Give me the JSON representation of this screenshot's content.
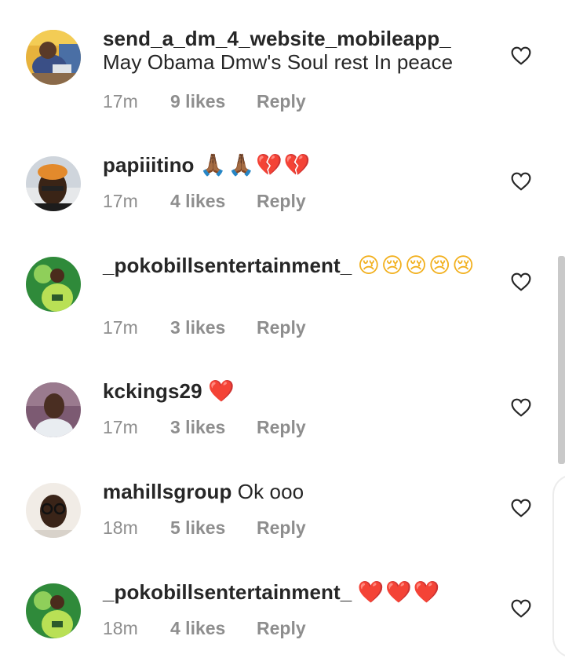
{
  "comments": [
    {
      "username": "send_a_dm_4_website_mobileapp_",
      "text": "May Obama Dmw's Soul rest In peace",
      "emoji": "",
      "emoji_color": "",
      "time": "17m",
      "likes": "9 likes",
      "reply": "Reply",
      "avatar_icon": "man-with-laptop-avatar"
    },
    {
      "username": "papiiitino",
      "text": "",
      "emoji": "🙏🏾🙏🏾💔💔",
      "emoji_color": "#e0202d",
      "time": "17m",
      "likes": "4 likes",
      "reply": "Reply",
      "avatar_icon": "orange-hair-avatar"
    },
    {
      "username": "_pokobillsentertainment_",
      "text": "",
      "emoji": "😢😢😢😢😢",
      "emoji_color": "",
      "time": "17m",
      "likes": "3 likes",
      "reply": "Reply",
      "avatar_icon": "basketball-player-avatar"
    },
    {
      "username": "kckings29",
      "text": "",
      "emoji": "❤️",
      "emoji_color": "#e0202d",
      "time": "17m",
      "likes": "3 likes",
      "reply": "Reply",
      "avatar_icon": "young-man-avatar"
    },
    {
      "username": "mahillsgroup",
      "text": "Ok ooo",
      "emoji": "",
      "emoji_color": "",
      "time": "18m",
      "likes": "5 likes",
      "reply": "Reply",
      "avatar_icon": "man-with-glasses-avatar"
    },
    {
      "username": "_pokobillsentertainment_",
      "text": "",
      "emoji": "❤️❤️❤️",
      "emoji_color": "#e0202d",
      "time": "18m",
      "likes": "4 likes",
      "reply": "Reply",
      "avatar_icon": "basketball-player-avatar"
    }
  ]
}
